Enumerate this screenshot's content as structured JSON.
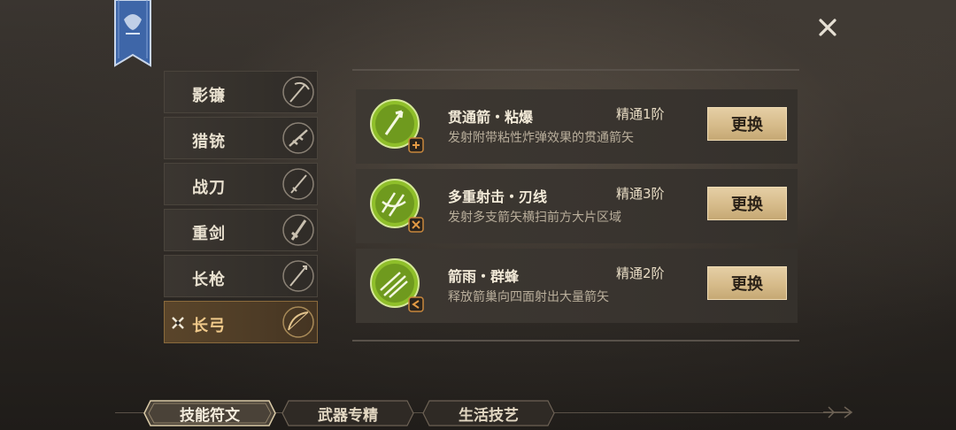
{
  "weapons": [
    {
      "label": "影镰",
      "icon": "scythe-icon"
    },
    {
      "label": "猎铳",
      "icon": "rifle-icon"
    },
    {
      "label": "战刀",
      "icon": "saber-icon"
    },
    {
      "label": "重剑",
      "icon": "greatsword-icon"
    },
    {
      "label": "长枪",
      "icon": "spear-icon"
    },
    {
      "label": "长弓",
      "icon": "longbow-icon",
      "selected": true
    }
  ],
  "skills": [
    {
      "name": "贯通箭・粘爆",
      "level": "精通1阶",
      "desc": "发射附带粘性炸弹效果的贯通箭矢",
      "button": "更换"
    },
    {
      "name": "多重射击・刃线",
      "level": "精通3阶",
      "desc": "发射多支箭矢横扫前方大片区域",
      "button": "更换"
    },
    {
      "name": "箭雨・群蜂",
      "level": "精通2阶",
      "desc": "释放箭巢向四面射出大量箭矢",
      "button": "更换"
    }
  ],
  "tabs": [
    {
      "label": "技能符文",
      "active": true
    },
    {
      "label": "武器专精",
      "active": false
    },
    {
      "label": "生活技艺",
      "active": false
    }
  ],
  "colors": {
    "accent": "#d6bb8a",
    "skill_green": "#8fbf2a",
    "selected_bg": "#5a452a"
  }
}
